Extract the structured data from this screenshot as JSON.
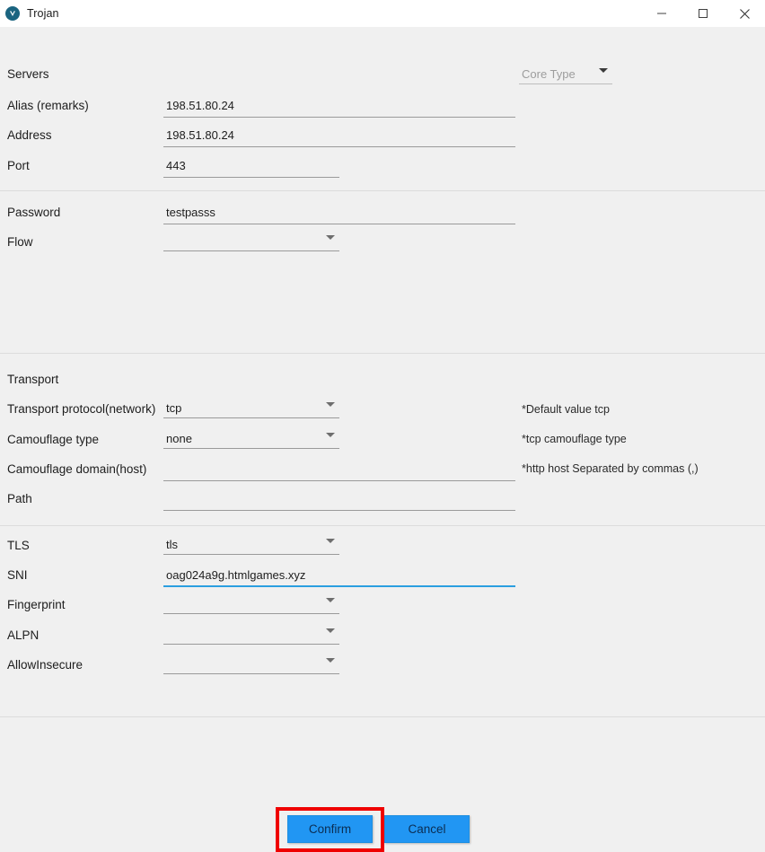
{
  "window": {
    "title": "Trojan",
    "icon": "v2ray-shield-icon",
    "controls": {
      "minimize": "minimize-icon",
      "maximize": "maximize-icon",
      "close": "close-icon"
    }
  },
  "colors": {
    "background": "#f0f0f0",
    "titlebar": "#ffffff",
    "accent": "#2196f3",
    "focus_underline": "#2b9fe0",
    "annotation": "#ef0000",
    "divider": "#dcdcdc",
    "field_underline": "#9a9a9a",
    "disabled_text": "#9d9d9d"
  },
  "core_type": {
    "label": "Core Type",
    "value": "",
    "placeholder": "Core Type",
    "disabled": true
  },
  "sections": {
    "servers": {
      "title": "Servers",
      "rows": [
        {
          "label": "Alias (remarks)",
          "value": "198.51.80.24",
          "type": "text",
          "width": "long"
        },
        {
          "label": "Address",
          "value": "198.51.80.24",
          "type": "text",
          "width": "long"
        },
        {
          "label": "Port",
          "value": "443",
          "type": "text",
          "width": "mid"
        }
      ]
    },
    "credentials": {
      "rows": [
        {
          "label": "Password",
          "value": "testpasss",
          "type": "text",
          "width": "long"
        },
        {
          "label": "Flow",
          "value": "",
          "type": "combo"
        }
      ]
    },
    "transport": {
      "title": "Transport",
      "rows": [
        {
          "label": "Transport protocol(network)",
          "value": "tcp",
          "type": "combo",
          "hint": "*Default value tcp"
        },
        {
          "label": "Camouflage type",
          "value": "none",
          "type": "combo",
          "hint": "*tcp camouflage type"
        },
        {
          "label": "Camouflage domain(host)",
          "value": "",
          "type": "text",
          "width": "long",
          "hint": "*http host Separated by commas (,)"
        },
        {
          "label": "Path",
          "value": "",
          "type": "text",
          "width": "long"
        }
      ]
    },
    "tls": {
      "rows": [
        {
          "label": "TLS",
          "value": "tls",
          "type": "combo"
        },
        {
          "label": "SNI",
          "value": "oag024a9g.htmlgames.xyz",
          "type": "text",
          "width": "long",
          "focused": true
        },
        {
          "label": "Fingerprint",
          "value": "",
          "type": "combo"
        },
        {
          "label": "ALPN",
          "value": "",
          "type": "combo"
        },
        {
          "label": "AllowInsecure",
          "value": "",
          "type": "combo"
        }
      ]
    }
  },
  "footer": {
    "confirm_label": "Confirm",
    "cancel_label": "Cancel",
    "highlighted": "confirm-button"
  }
}
